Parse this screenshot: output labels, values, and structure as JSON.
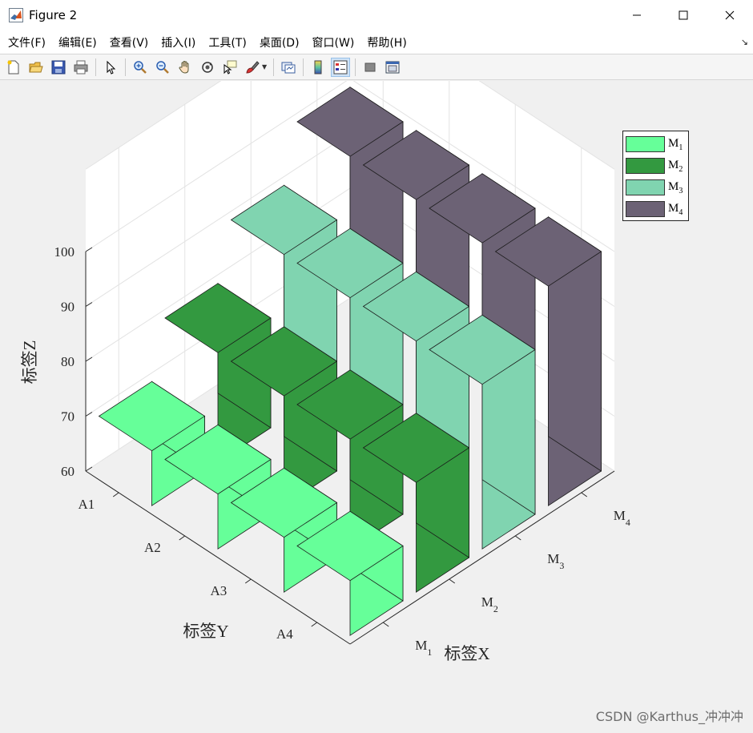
{
  "window": {
    "title": "Figure 2"
  },
  "menu": [
    "文件(F)",
    "编辑(E)",
    "查看(V)",
    "插入(I)",
    "工具(T)",
    "桌面(D)",
    "窗口(W)",
    "帮助(H)"
  ],
  "toolbar": {
    "icons": [
      "new-figure-icon",
      "open-file-icon",
      "save-icon",
      "print-icon",
      "select-arrow-icon",
      "zoom-in-icon",
      "zoom-out-icon",
      "pan-hand-icon",
      "rotate-3d-icon",
      "data-cursor-icon",
      "brush-icon",
      "link-plot-icon",
      "colorbar-icon",
      "legend-icon",
      "hide-plot-tools-icon",
      "show-plot-tools-icon"
    ]
  },
  "watermark": "CSDN @Karthus_冲冲冲",
  "chart_data": {
    "type": "bar3",
    "xlabel": "标签X",
    "ylabel": "标签Y",
    "zlabel": "标签Z",
    "x_categories": [
      "M1",
      "M2",
      "M3",
      "M4"
    ],
    "y_categories": [
      "A1",
      "A2",
      "A3",
      "A4"
    ],
    "zlim": [
      60,
      100
    ],
    "z_ticks": [
      60,
      70,
      80,
      90,
      100
    ],
    "grid": true,
    "series": [
      {
        "name": "M1",
        "color": "#66ff99",
        "values": [
          70,
          70,
          70,
          70
        ]
      },
      {
        "name": "M2",
        "color": "#339940",
        "values": [
          80,
          80,
          80,
          80
        ]
      },
      {
        "name": "M3",
        "color": "#80d4b0",
        "values": [
          90,
          90,
          90,
          90
        ]
      },
      {
        "name": "M4",
        "color": "#6c6275",
        "values": [
          100,
          100,
          100,
          100
        ]
      }
    ],
    "legend": {
      "position": "top-right"
    }
  }
}
